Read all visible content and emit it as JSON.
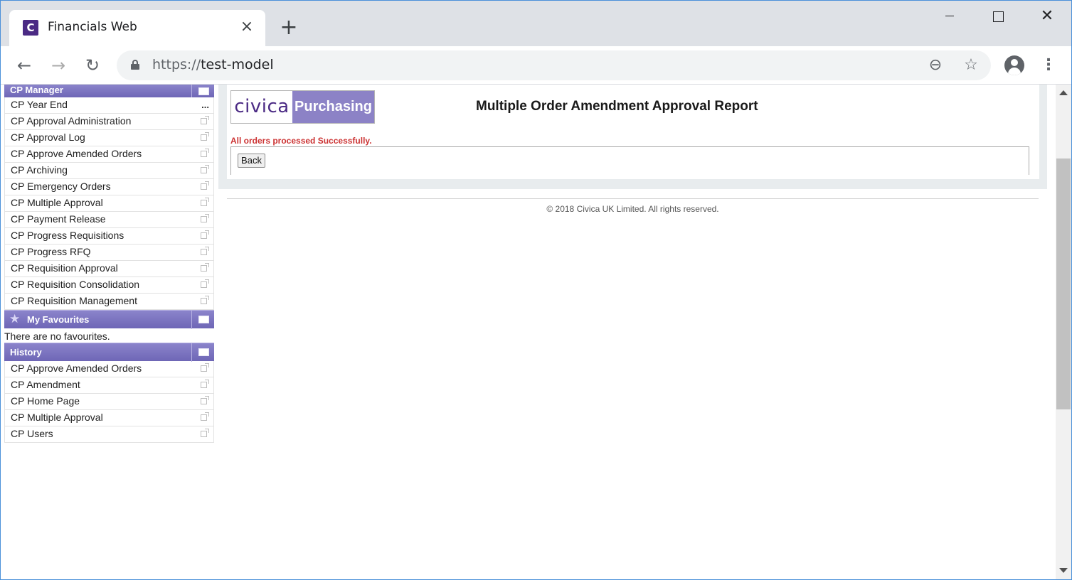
{
  "browser": {
    "tab_title": "Financials Web",
    "tab_favicon_letter": "C",
    "tab_close": "×",
    "new_tab": "+",
    "url_scheme": "https://",
    "url_host": "test-model",
    "window_close": "✕"
  },
  "sidebar": {
    "cp_manager": {
      "title": "CP Manager",
      "items": [
        {
          "label": "CP Year End",
          "icon": "ellipsis-icon"
        },
        {
          "label": "CP Approval Administration",
          "icon": "external-link-icon"
        },
        {
          "label": "CP Approval Log",
          "icon": "external-link-icon"
        },
        {
          "label": "CP Approve Amended Orders",
          "icon": "external-link-icon"
        },
        {
          "label": "CP Archiving",
          "icon": "external-link-icon"
        },
        {
          "label": "CP Emergency Orders",
          "icon": "external-link-icon"
        },
        {
          "label": "CP Multiple Approval",
          "icon": "external-link-icon"
        },
        {
          "label": "CP Payment Release",
          "icon": "external-link-icon"
        },
        {
          "label": "CP Progress Requisitions",
          "icon": "external-link-icon"
        },
        {
          "label": "CP Progress RFQ",
          "icon": "external-link-icon"
        },
        {
          "label": "CP Requisition Approval",
          "icon": "external-link-icon"
        },
        {
          "label": "CP Requisition Consolidation",
          "icon": "external-link-icon"
        },
        {
          "label": "CP Requisition Management",
          "icon": "external-link-icon"
        }
      ],
      "more_label": "..."
    },
    "favourites": {
      "title": "My Favourites",
      "empty_text": "There are no favourites."
    },
    "history": {
      "title": "History",
      "items": [
        {
          "label": "CP Approve Amended Orders"
        },
        {
          "label": "CP Amendment"
        },
        {
          "label": "CP Home Page"
        },
        {
          "label": "CP Multiple Approval"
        },
        {
          "label": "CP Users"
        }
      ]
    }
  },
  "main": {
    "logo_left": "civica",
    "logo_right": "Purchasing",
    "report_title": "Multiple Order Amendment Approval Report",
    "success_message": "All orders processed Successfully.",
    "back_label": "Back"
  },
  "footer": {
    "copyright": "© 2018 Civica UK Limited. All rights reserved."
  },
  "colors": {
    "panel_header": "#7a73c0",
    "brand_purple": "#4b2a84",
    "purchasing_bg": "#8c82c6",
    "success_text": "#cc3333"
  }
}
